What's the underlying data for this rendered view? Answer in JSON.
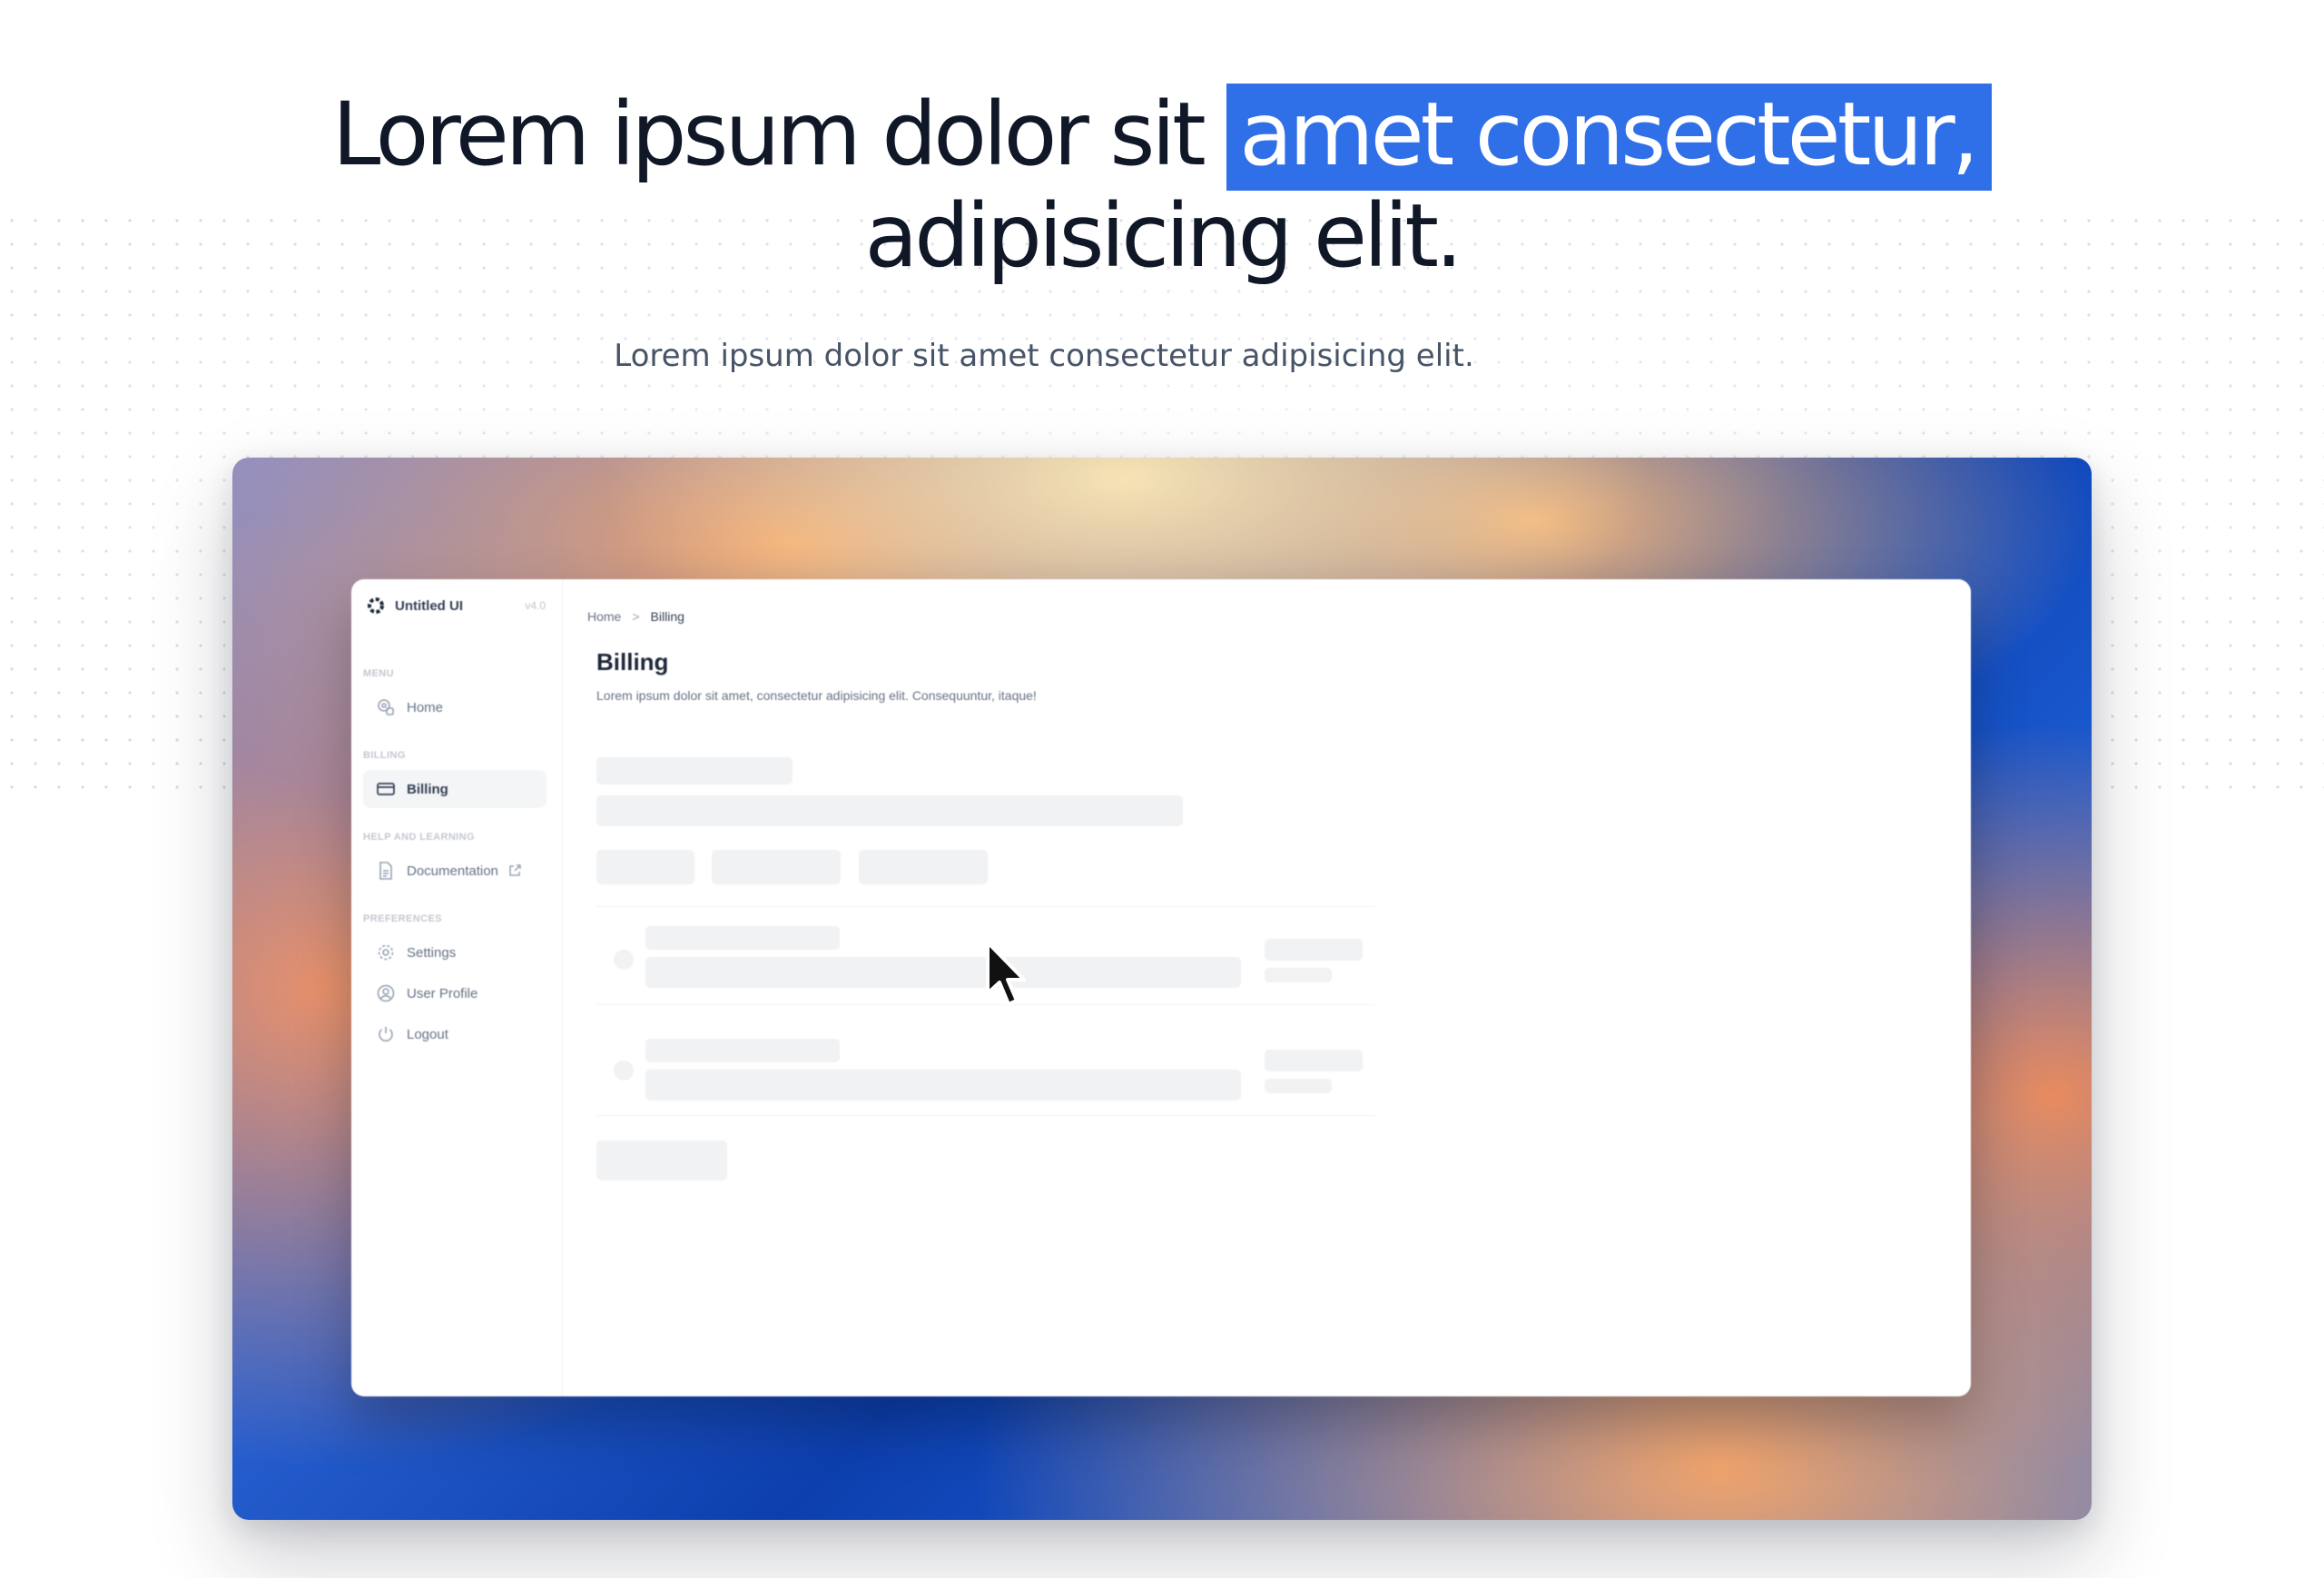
{
  "hero": {
    "title_part1": "Lorem ipsum dolor sit ",
    "title_highlight": "amet consectetur,",
    "title_line2": "adipisicing elit.",
    "subtitle": "Lorem ipsum dolor sit amet consectetur adipisicing elit.",
    "highlight_color": "#2f6fe8"
  },
  "app": {
    "brand": {
      "name": "Untitled UI",
      "version": "v4.0"
    },
    "sections": {
      "menu": "MENU",
      "billing": "BILLING",
      "help": "HELP AND LEARNING",
      "preferences": "PREFERENCES"
    },
    "nav": {
      "home": "Home",
      "billing": "Billing",
      "documentation": "Documentation",
      "settings": "Settings",
      "user_profile": "User Profile",
      "logout": "Logout"
    },
    "breadcrumb": {
      "home": "Home",
      "separator": ">",
      "current": "Billing"
    },
    "page": {
      "title": "Billing",
      "description": "Lorem ipsum dolor sit amet, consectetur adipisicing elit. Consequuntur, itaque!"
    }
  }
}
